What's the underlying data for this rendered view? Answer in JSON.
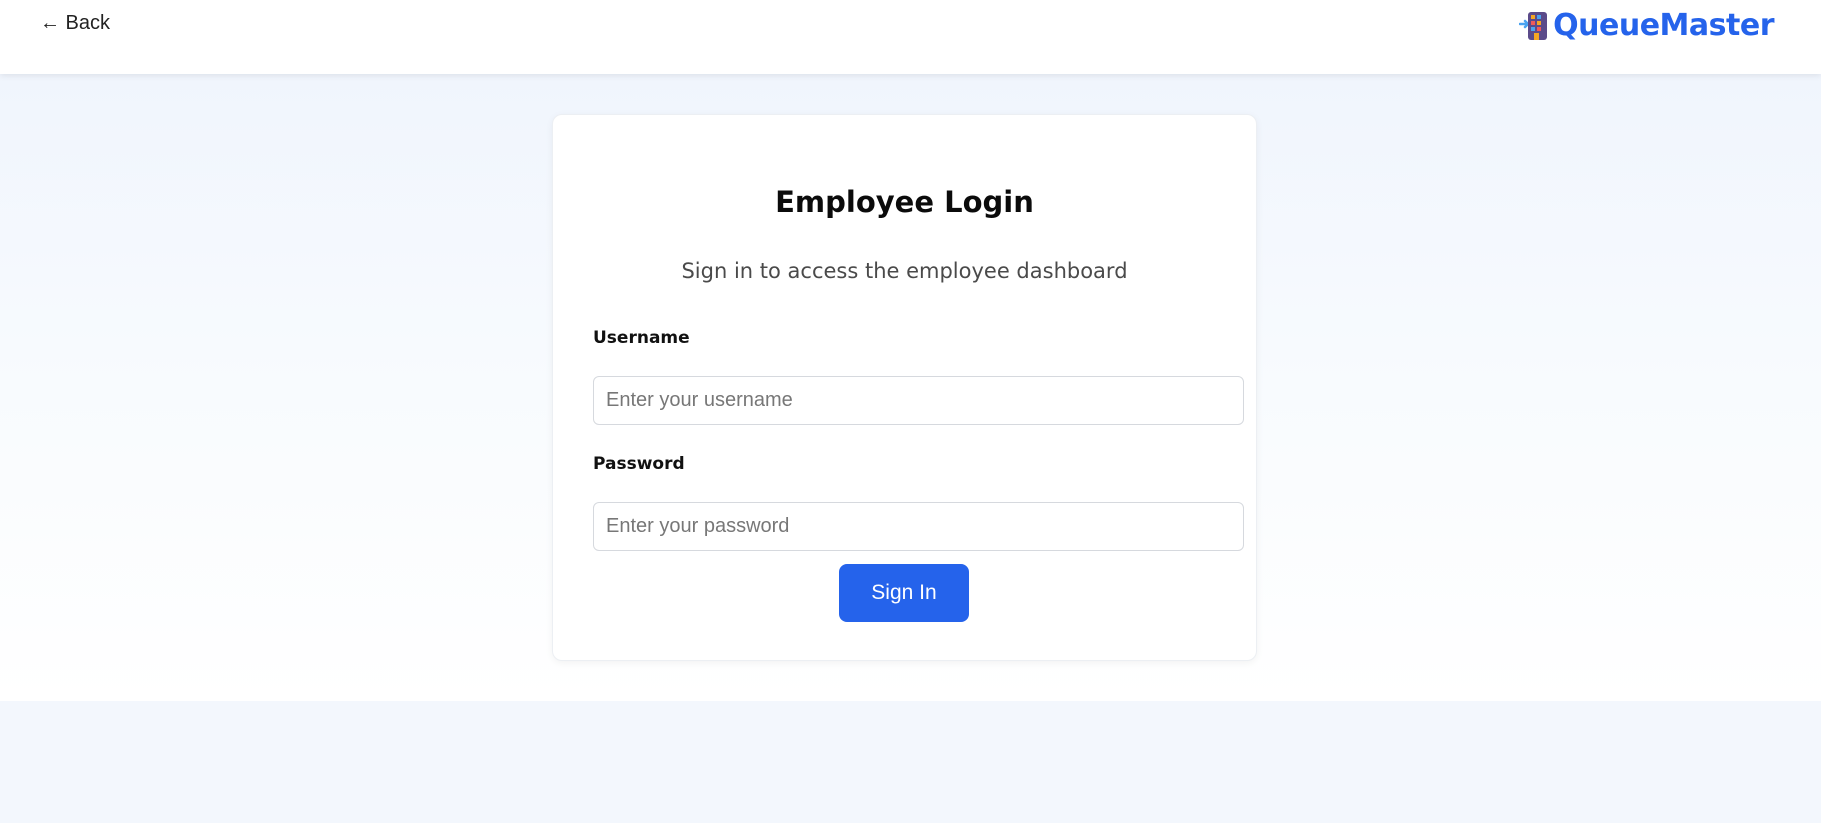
{
  "header": {
    "back_label": "← Back",
    "brand_name": "QueueMaster",
    "brand_icon": "building-queue-icon"
  },
  "login_card": {
    "title": "Employee Login",
    "subtitle": "Sign in to access the employee dashboard",
    "username": {
      "label": "Username",
      "value": "",
      "placeholder": "Enter your username"
    },
    "password": {
      "label": "Password",
      "value": "",
      "placeholder": "Enter your password"
    },
    "submit_label": "Sign In"
  },
  "colors": {
    "accent": "#2563eb",
    "page_background": "#f3f7fd",
    "card_background": "#ffffff"
  }
}
